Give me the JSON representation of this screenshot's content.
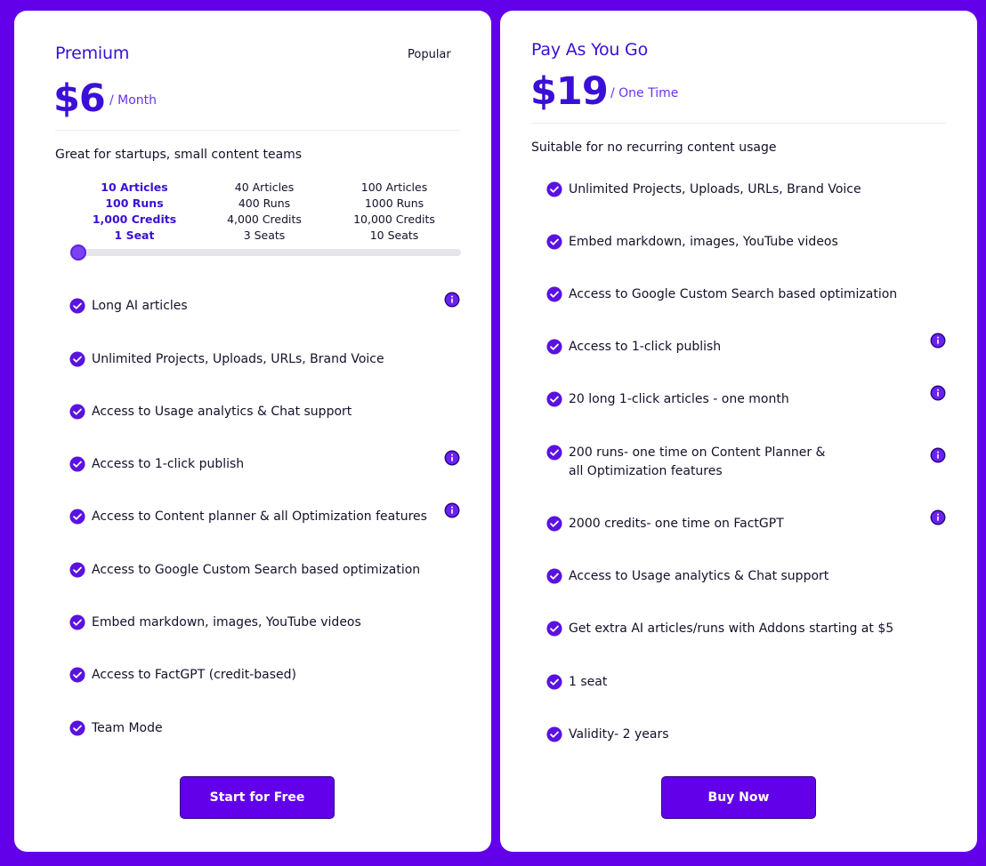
{
  "premium": {
    "name": "Premium",
    "badge": "Popular",
    "price": "$6",
    "period": "/ Month",
    "tagline": "Great for startups, small content teams",
    "tiers": [
      {
        "articles": "10 Articles",
        "runs": "100 Runs",
        "credits": "1,000 Credits",
        "seats": "1 Seat"
      },
      {
        "articles": "40 Articles",
        "runs": "400 Runs",
        "credits": "4,000 Credits",
        "seats": "3 Seats"
      },
      {
        "articles": "100 Articles",
        "runs": "1000 Runs",
        "credits": "10,000 Credits",
        "seats": "10 Seats"
      }
    ],
    "selected_tier": 0,
    "features": [
      "Long AI articles",
      "Unlimited Projects, Uploads, URLs, Brand Voice",
      "Access to Usage analytics & Chat support",
      "Access to 1-click publish",
      "Access to Content planner & all Optimization features",
      "Access to Google Custom Search based optimization",
      "Embed markdown, images, YouTube videos",
      "Access to FactGPT (credit-based)",
      "Team Mode"
    ],
    "cta_label": "Start for Free"
  },
  "payg": {
    "name": "Pay As You Go",
    "price": "$19",
    "period": "/ One Time",
    "tagline": "Suitable for no recurring content usage",
    "features": [
      "Unlimited Projects, Uploads, URLs, Brand Voice",
      "Embed markdown, images, YouTube videos",
      "Access to Google Custom Search based optimization",
      "Access to 1-click publish",
      "20 long 1-click articles - one month",
      "200 runs- one time on Content Planner & all Optimization features",
      "2000 credits- one time on FactGPT",
      "Access to Usage analytics & Chat support",
      "Get extra AI articles/runs with Addons starting at $5",
      "1 seat",
      "Validity- 2 years"
    ],
    "cta_label": "Buy Now"
  },
  "colors": {
    "background": "#6200ea",
    "accent": "#3a0fd6",
    "check": "#5a12e0",
    "card": "#ffffff"
  },
  "icons": {
    "check": "check-circle-icon",
    "info": "info-icon"
  }
}
